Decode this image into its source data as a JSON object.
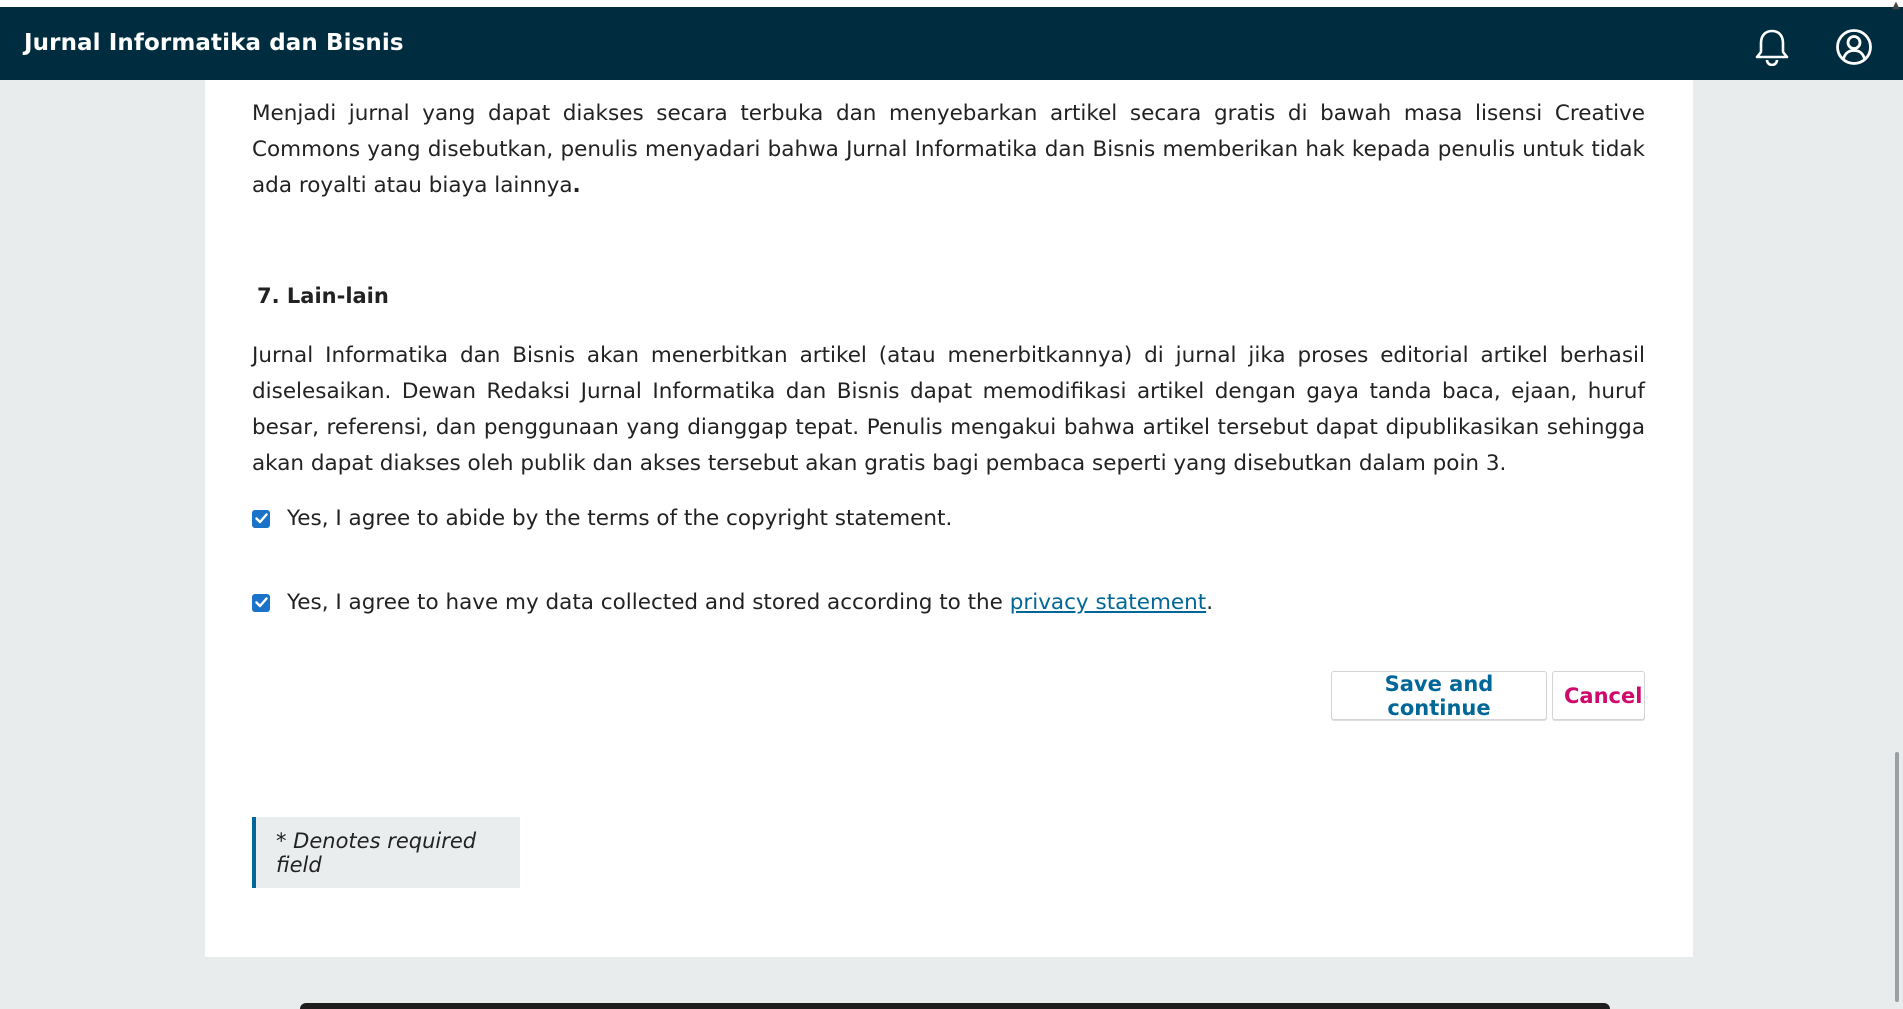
{
  "header": {
    "title": "Jurnal Informatika dan Bisnis",
    "icons": [
      "bell-icon",
      "user-icon"
    ],
    "background": "#002c40"
  },
  "content": {
    "paragraph_top": "Menjadi jurnal yang dapat diakses secara terbuka dan menyebarkan artikel secara gratis di bawah masa lisensi Creative Commons yang disebutkan, penulis menyadari bahwa Jurnal Informatika dan Bisnis memberikan hak kepada penulis untuk tidak ada royalti atau biaya lainnya",
    "paragraph_top_end": ".",
    "section_heading": "7. Lain-lain",
    "paragraph_section": "Jurnal Informatika dan Bisnis akan menerbitkan artikel (atau menerbitkannya) di jurnal jika proses editorial artikel berhasil diselesaikan. Dewan Redaksi Jurnal Informatika dan Bisnis dapat memodifikasi artikel dengan gaya tanda baca, ejaan, huruf besar, referensi, dan penggunaan yang dianggap tepat. Penulis mengakui bahwa artikel tersebut dapat dipublikasikan sehingga akan dapat diakses oleh publik dan akses tersebut akan gratis bagi pembaca seperti yang disebutkan dalam poin 3."
  },
  "checks": {
    "copyright_label": "Yes, I agree to abide by the terms of the copyright statement.",
    "copyright_checked": true,
    "privacy_label_prefix": "Yes, I agree to have my data collected and stored according to the ",
    "privacy_link": "privacy statement",
    "privacy_label_suffix": ".",
    "privacy_checked": true
  },
  "actions": {
    "save_label": "Save and continue",
    "cancel_label": "Cancel",
    "save_color": "#006798",
    "cancel_color": "#d00a6c"
  },
  "notice": {
    "required_text": "* Denotes required field"
  }
}
